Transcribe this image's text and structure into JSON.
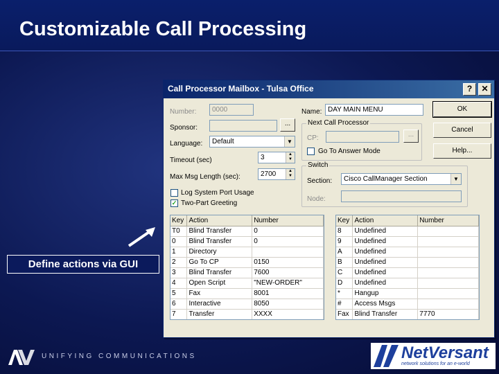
{
  "slide": {
    "title": "Customizable Call Processing",
    "callout": "Define actions via GUI",
    "footer_text": "UNIFYING COMMUNICATIONS",
    "netversant_name": "NetVersant",
    "netversant_tagline": "network solutions for an e-world",
    "avst_logo_text": "AVST"
  },
  "dialog": {
    "title": "Call Processor Mailbox - Tulsa Office",
    "help_glyph": "?",
    "close_glyph": "✕",
    "number_label": "Number:",
    "number_value": "0000",
    "sponsor_label": "Sponsor:",
    "sponsor_value": "",
    "browse_glyph": "...",
    "language_label": "Language:",
    "language_value": "Default",
    "timeout_label": "Timeout (sec)",
    "timeout_value": "3",
    "maxmsg_label": "Max Msg Length (sec):",
    "maxmsg_value": "2700",
    "log_label": "Log System Port Usage",
    "log_checked": false,
    "twopart_label": "Two-Part Greeting",
    "twopart_checked": true,
    "name_label": "Name:",
    "name_value": "DAY MAIN MENU",
    "next_group_label": "Next Call Processor",
    "cp_label": "CP:",
    "cp_value": "",
    "answer_mode_label": "Go To Answer Mode",
    "answer_mode_checked": false,
    "switch_group_label": "Switch",
    "section_label": "Section:",
    "section_value": "Cisco CallManager Section",
    "node_label": "Node:",
    "node_value": "",
    "ok_label": "OK",
    "cancel_label": "Cancel",
    "help_label": "Help...",
    "table_headers": [
      "Key",
      "Action",
      "Number"
    ],
    "left_rows": [
      [
        "T0",
        "Blind Transfer",
        "0"
      ],
      [
        "0",
        "Blind Transfer",
        "0"
      ],
      [
        "1",
        "Directory",
        ""
      ],
      [
        "2",
        "Go To CP",
        "0150"
      ],
      [
        "3",
        "Blind Transfer",
        "7600"
      ],
      [
        "4",
        "Open Script",
        "\"NEW-ORDER\""
      ],
      [
        "5",
        "Fax",
        "8001"
      ],
      [
        "6",
        "Interactive",
        "8050"
      ],
      [
        "7",
        "Transfer",
        "XXXX"
      ]
    ],
    "right_rows": [
      [
        "8",
        "Undefined",
        ""
      ],
      [
        "9",
        "Undefined",
        ""
      ],
      [
        "A",
        "Undefined",
        ""
      ],
      [
        "B",
        "Undefined",
        ""
      ],
      [
        "C",
        "Undefined",
        ""
      ],
      [
        "D",
        "Undefined",
        ""
      ],
      [
        "*",
        "Hangup",
        ""
      ],
      [
        "#",
        "Access Msgs",
        ""
      ],
      [
        "Fax",
        "Blind Transfer",
        "7770"
      ]
    ]
  },
  "colors": {
    "slide_bg": "#0c1852",
    "title_bar": "#0a1f6b",
    "dialog_bg": "#ece9d8",
    "dialog_titlebar": "#0a246a",
    "netversant_blue": "#1d3f9c"
  }
}
